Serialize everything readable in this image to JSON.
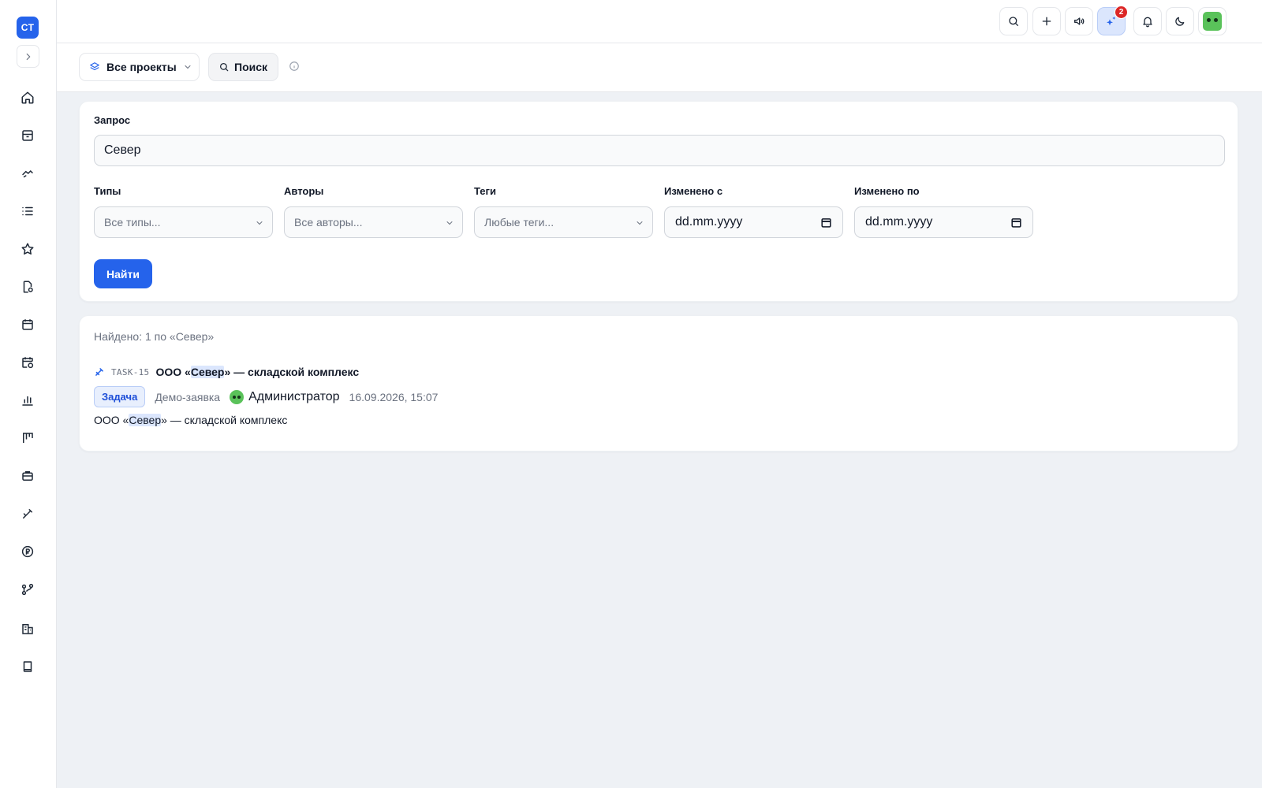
{
  "app": {
    "logo_text": "CT"
  },
  "sidebar": {
    "items": [
      {
        "icon": "home-icon"
      },
      {
        "icon": "inbox-icon"
      },
      {
        "icon": "handshake-icon"
      },
      {
        "icon": "list-icon"
      },
      {
        "icon": "star-icon"
      },
      {
        "icon": "document-icon"
      },
      {
        "icon": "calendar-icon"
      },
      {
        "icon": "calendar-clock-icon"
      },
      {
        "icon": "bar-chart-icon"
      },
      {
        "icon": "kanban-icon"
      },
      {
        "icon": "briefcase-icon"
      },
      {
        "icon": "wrench-icon"
      },
      {
        "icon": "ruble-icon"
      },
      {
        "icon": "git-branch-icon"
      },
      {
        "icon": "building-icon"
      },
      {
        "icon": "book-icon"
      }
    ]
  },
  "topbar": {
    "notifications_badge": "2",
    "accent_color": "#2563eb"
  },
  "subbar": {
    "projects_label": "Все проекты",
    "search_label": "Поиск"
  },
  "search_form": {
    "query_label": "Запрос",
    "query_value": "Север",
    "types_label": "Типы",
    "types_placeholder": "Все типы...",
    "authors_label": "Авторы",
    "authors_placeholder": "Все авторы...",
    "tags_label": "Теги",
    "tags_placeholder": "Любые теги...",
    "changed_from_label": "Изменено с",
    "changed_from_placeholder": "dd.mm.yyyy",
    "changed_to_label": "Изменено по",
    "changed_to_placeholder": "dd.mm.yyyy",
    "submit_label": "Найти"
  },
  "results": {
    "summary": "Найдено: 1 по «Север»",
    "items": [
      {
        "key": "TASK-15",
        "title_before": "ООО «",
        "title_highlight": "Север",
        "title_after": "» — складской комплекс",
        "type": "Задача",
        "project": "Демо-заявка",
        "author": "Администратор",
        "date": "16.09.2026, 15:07",
        "snippet_before": "ООО «",
        "snippet_highlight": "Север",
        "snippet_after": "» — складской комплекс"
      }
    ]
  }
}
